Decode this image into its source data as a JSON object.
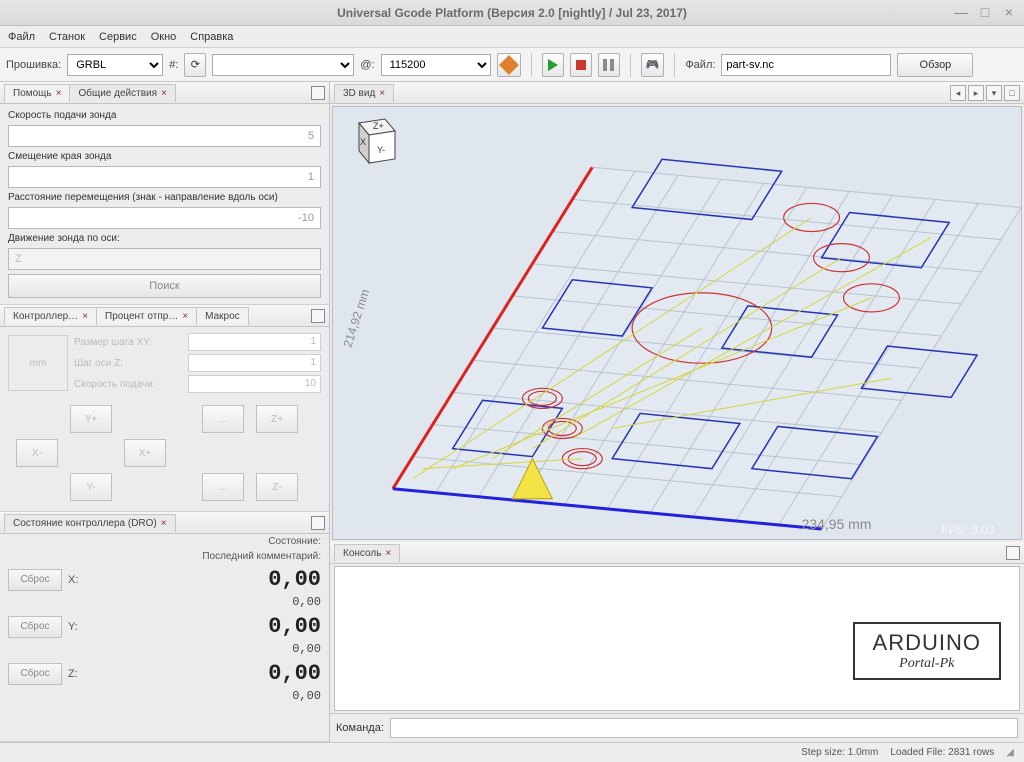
{
  "window": {
    "title": "Universal Gcode Platform (Версия 2.0 [nightly]  / Jul 23, 2017)"
  },
  "menu": {
    "file": "Файл",
    "stanok": "Станок",
    "service": "Сервис",
    "window": "Окно",
    "help": "Справка"
  },
  "toolbar": {
    "firmware_label": "Прошивка:",
    "firmware_value": "GRBL",
    "port_label": "#:",
    "at_label": "@:",
    "baud": "115200",
    "file_label": "Файл:",
    "file_value": "part-sv.nc",
    "browse": "Обзор"
  },
  "help_tabs": {
    "help": "Помощь",
    "common": "Общие действия"
  },
  "probe": {
    "feed_label": "Скорость подачи зонда",
    "feed_value": "5",
    "offset_label": "Смещение края зонда",
    "offset_value": "1",
    "dist_label": "Расстояние перемещения (знак - направление вдоль оси)",
    "dist_value": "-10",
    "axis_label": "Движение зонда по оси:",
    "axis_value": "Z",
    "search": "Поиск"
  },
  "ctrl_tabs": {
    "controller": "Контроллер…",
    "percent": "Процент отпр…",
    "macro": "Макрос"
  },
  "jog": {
    "unit": "mm",
    "step_xy_label": "Размер шага XY:",
    "step_xy": "1",
    "step_z_label": "Шаг оси Z:",
    "step_z": "1",
    "feed_label": "Скорость подачи:",
    "feed": "10",
    "yplus": "Y+",
    "yminus": "Y-",
    "xminus": "X-",
    "xplus": "X+",
    "zplus": "Z+",
    "zminus": "Z-",
    "blank": "…"
  },
  "dro_tab": "Состояние контроллера (DRO)",
  "dro": {
    "state_label": "Состояние:",
    "comment_label": "Последний комментарий:",
    "reset": "Сброс",
    "x_axis": "X:",
    "y_axis": "Y:",
    "z_axis": "Z:",
    "x_big": "0,00",
    "x_small": "0,00",
    "y_big": "0,00",
    "y_small": "0,00",
    "z_big": "0,00",
    "z_small": "0,00"
  },
  "view": {
    "tab": "3D вид",
    "dim_x": "234,95 mm",
    "dim_y": "214,92 mm",
    "fps": "FPS: 3.03",
    "cube_z": "Z+",
    "cube_x": "X",
    "cube_y": "Y-"
  },
  "console": {
    "tab": "Консоль",
    "cmd_label": "Команда:",
    "wm1": "ARDUINO",
    "wm2": "Portal-Pk"
  },
  "status": {
    "step": "Step size: 1.0mm",
    "loaded": "Loaded File: 2831 rows"
  }
}
